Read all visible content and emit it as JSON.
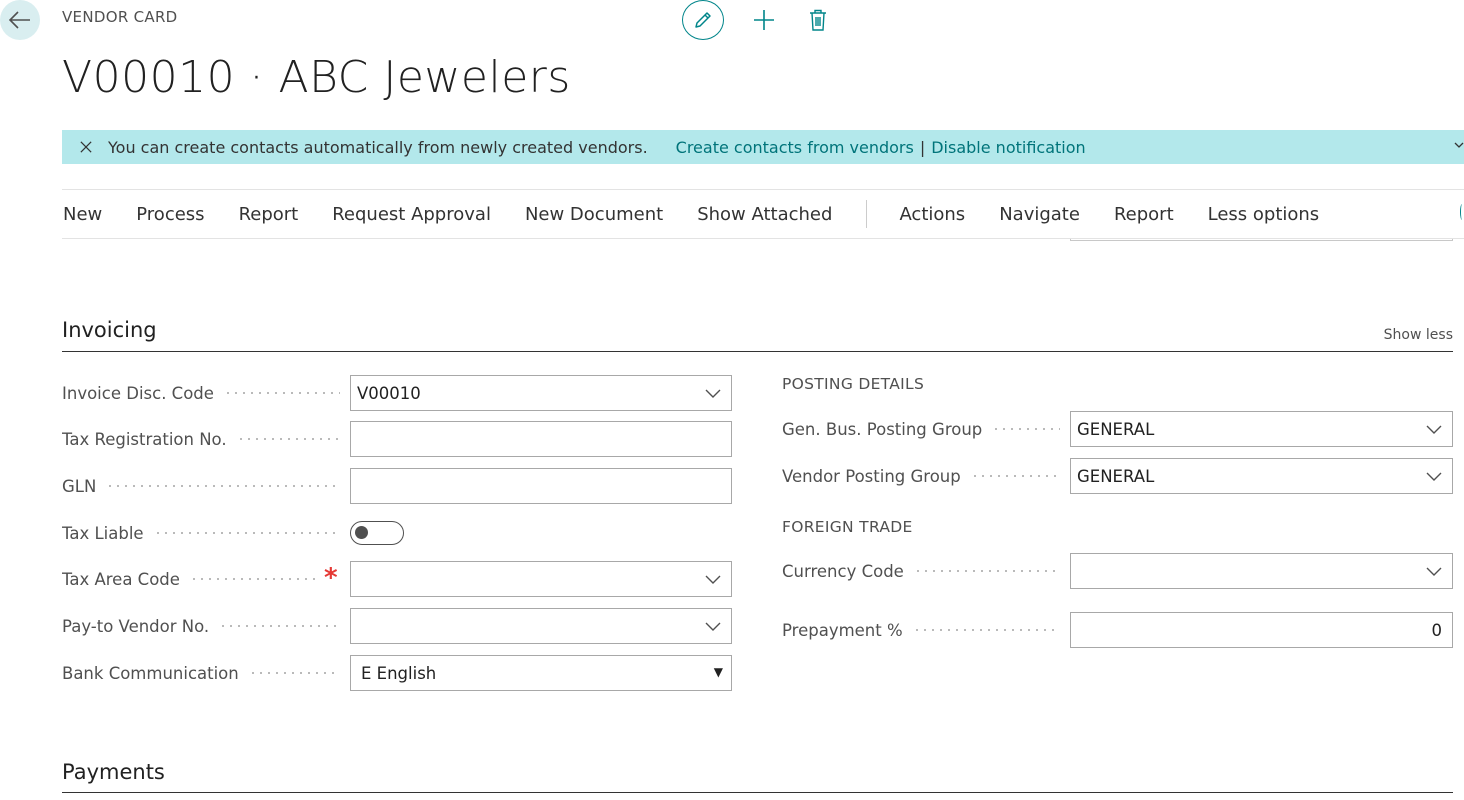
{
  "header": {
    "caption": "VENDOR CARD",
    "title": "V00010 · ABC Jewelers"
  },
  "notification": {
    "message": "You can create contacts automatically from newly created vendors.",
    "link_create": "Create contacts from vendors",
    "separator": "|",
    "link_disable": "Disable notification"
  },
  "actionbar": {
    "items": [
      "New",
      "Process",
      "Report",
      "Request Approval",
      "New Document",
      "Show Attached"
    ],
    "items2": [
      "Actions",
      "Navigate",
      "Report",
      "Less options"
    ]
  },
  "invoicing": {
    "title": "Invoicing",
    "toggle": "Show less",
    "fields": {
      "invoice_disc_code": {
        "label": "Invoice Disc. Code",
        "value": "V00010"
      },
      "tax_registration_no": {
        "label": "Tax Registration No.",
        "value": ""
      },
      "gln": {
        "label": "GLN",
        "value": ""
      },
      "tax_liable": {
        "label": "Tax Liable",
        "value": false
      },
      "tax_area_code": {
        "label": "Tax Area Code",
        "value": "",
        "required_mark": "*"
      },
      "pay_to_vendor_no": {
        "label": "Pay-to Vendor No.",
        "value": ""
      },
      "bank_communication": {
        "label": "Bank Communication",
        "value": "E English"
      }
    },
    "posting_details": {
      "title": "POSTING DETAILS",
      "gen_bus_posting_group": {
        "label": "Gen. Bus. Posting Group",
        "value": "GENERAL"
      },
      "vendor_posting_group": {
        "label": "Vendor Posting Group",
        "value": "GENERAL"
      }
    },
    "foreign_trade": {
      "title": "FOREIGN TRADE",
      "currency_code": {
        "label": "Currency Code",
        "value": ""
      },
      "prepayment_pct": {
        "label": "Prepayment %",
        "value": "0"
      }
    }
  },
  "payments": {
    "title": "Payments"
  },
  "colors": {
    "accent": "#00858a",
    "notification_bg": "#b3e8eb",
    "link": "#00747a",
    "required": "#e53935"
  }
}
